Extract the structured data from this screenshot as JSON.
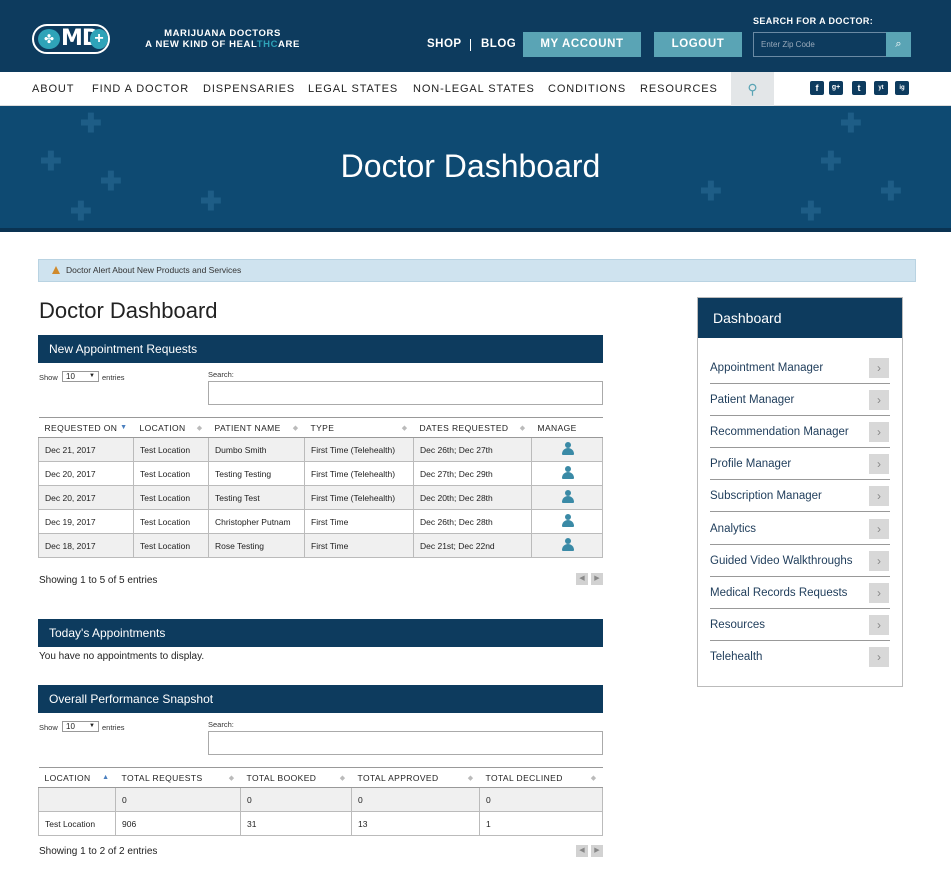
{
  "header": {
    "logo_text": "MD",
    "tagline_line1": "MARIJUANA DOCTORS",
    "tagline_line2_a": "A NEW KIND OF HEAL",
    "tagline_line2_b": "THC",
    "tagline_line2_c": "ARE",
    "shop": "SHOP",
    "blog": "BLOG",
    "my_account": "MY ACCOUNT",
    "logout": "LOGOUT",
    "search_doctor_label": "SEARCH FOR A DOCTOR:",
    "zip_placeholder": "Enter Zip Code",
    "brand_color": "#0d3b5e",
    "accent_color": "#5aa4b5"
  },
  "nav": {
    "items": [
      "ABOUT",
      "FIND A DOCTOR",
      "DISPENSARIES",
      "LEGAL STATES",
      "NON-LEGAL STATES",
      "CONDITIONS",
      "RESOURCES"
    ],
    "social": [
      "f",
      "g+",
      "t",
      "yt",
      "ig"
    ]
  },
  "hero": {
    "title": "Doctor Dashboard"
  },
  "alert": {
    "text": "Doctor Alert About New Products and Services"
  },
  "main": {
    "page_title": "Doctor Dashboard",
    "appointments": {
      "title": "New Appointment Requests",
      "show_label": "Show",
      "show_value": "10",
      "entries_label": "entries",
      "search_label": "Search:",
      "columns": [
        "REQUESTED ON",
        "LOCATION",
        "PATIENT NAME",
        "TYPE",
        "DATES REQUESTED",
        "MANAGE"
      ],
      "rows": [
        [
          "Dec 21, 2017",
          "Test Location",
          "Dumbo Smith",
          "First Time (Telehealth)",
          "Dec 26th; Dec 27th"
        ],
        [
          "Dec 20, 2017",
          "Test Location",
          "Testing Testing",
          "First Time (Telehealth)",
          "Dec 27th; Dec 29th"
        ],
        [
          "Dec 20, 2017",
          "Test Location",
          "Testing Test",
          "First Time (Telehealth)",
          "Dec 20th; Dec 28th"
        ],
        [
          "Dec 19, 2017",
          "Test Location",
          "Christopher Putnam",
          "First Time",
          "Dec 26th; Dec 28th"
        ],
        [
          "Dec 18, 2017",
          "Test Location",
          "Rose Testing",
          "First Time",
          "Dec 21st; Dec 22nd"
        ]
      ],
      "info": "Showing 1 to 5 of 5 entries"
    },
    "today": {
      "title": "Today's Appointments",
      "empty": "You have no appointments to display."
    },
    "performance": {
      "title": "Overall Performance Snapshot",
      "show_label": "Show",
      "show_value": "10",
      "entries_label": "entries",
      "search_label": "Search:",
      "columns": [
        "LOCATION",
        "TOTAL REQUESTS",
        "TOTAL BOOKED",
        "TOTAL APPROVED",
        "TOTAL DECLINED"
      ],
      "rows": [
        [
          "",
          "0",
          "0",
          "0",
          "0"
        ],
        [
          "Test Location",
          "906",
          "31",
          "13",
          "1"
        ]
      ],
      "info": "Showing 1 to 2 of 2 entries"
    }
  },
  "sidebar": {
    "title": "Dashboard",
    "items": [
      "Appointment Manager",
      "Patient Manager",
      "Recommendation Manager",
      "Profile Manager",
      "Subscription Manager",
      "Analytics",
      "Guided Video Walkthroughs",
      "Medical Records Requests",
      "Resources",
      "Telehealth"
    ]
  }
}
